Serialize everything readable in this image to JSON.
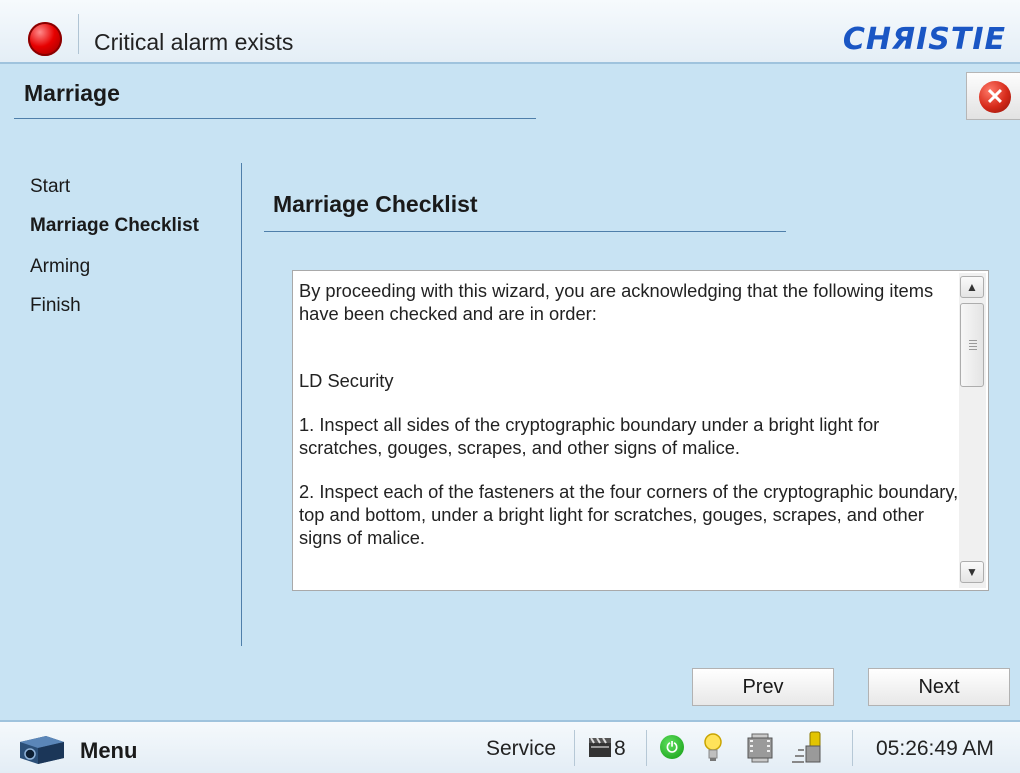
{
  "header": {
    "alarm_text": "Critical alarm exists",
    "brand": "CHЯISTIE"
  },
  "page": {
    "title": "Marriage"
  },
  "nav": {
    "items": [
      "Start",
      "Marriage Checklist",
      "Arming",
      "Finish"
    ],
    "active": "Marriage Checklist"
  },
  "section": {
    "title": "Marriage Checklist"
  },
  "checklist": {
    "intro": "By proceeding with this wizard, you are acknowledging that the following items have been checked and are in order:",
    "heading": "LD Security",
    "item1": "1. Inspect all sides of the cryptographic boundary under a bright light for scratches, gouges, scrapes, and other signs of malice.",
    "item2": "2. Inspect each of the fasteners at the four corners of the cryptographic boundary, top and bottom, under a bright light for scratches, gouges, scrapes, and other signs of malice."
  },
  "buttons": {
    "prev": "Prev",
    "next": "Next"
  },
  "statusbar": {
    "menu_label": "Menu",
    "service_label": "Service",
    "count": "8",
    "time": "05:26:49 AM"
  },
  "colors": {
    "background": "#c8e3f3",
    "brand": "#1a56c4",
    "alarm": "#e60000",
    "divider": "#4f7faa"
  }
}
